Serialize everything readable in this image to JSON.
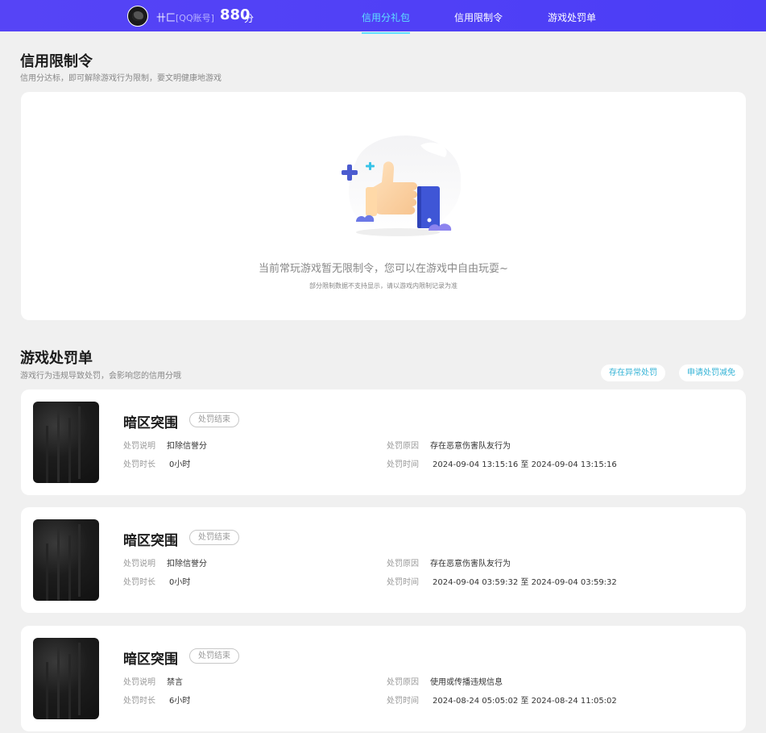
{
  "topbar": {
    "username": "卄匚",
    "account_type": "[QQ账号]",
    "score": "880",
    "score_unit": "分",
    "tabs": [
      {
        "label": "信用分礼包",
        "active": true
      },
      {
        "label": "信用限制令",
        "active": false
      },
      {
        "label": "游戏处罚单",
        "active": false
      }
    ]
  },
  "restriction": {
    "title": "信用限制令",
    "subtitle": "信用分达标，即可解除游戏行为限制，要文明健康地游戏",
    "empty_text": "当前常玩游戏暂无限制令，您可以在游戏中自由玩耍~",
    "empty_note": "部分限制数据不支持显示，请以游戏内限制记录为准"
  },
  "penalty": {
    "title": "游戏处罚单",
    "subtitle": "游戏行为违规导致处罚，会影响您的信用分哦",
    "actions": [
      "存在异常处罚",
      "申请处罚减免"
    ],
    "labels": {
      "desc": "处罚说明",
      "duration": "处罚时长",
      "reason": "处罚原因",
      "time": "处罚时间"
    },
    "items": [
      {
        "game": "暗区突围",
        "status": "处罚结束",
        "desc": "扣除信誉分",
        "duration": "0小时",
        "reason": "存在恶意伤害队友行为",
        "time": "2024-09-04 13:15:16 至 2024-09-04 13:15:16"
      },
      {
        "game": "暗区突围",
        "status": "处罚结束",
        "desc": "扣除信誉分",
        "duration": "0小时",
        "reason": "存在恶意伤害队友行为",
        "time": "2024-09-04 03:59:32 至 2024-09-04 03:59:32"
      },
      {
        "game": "暗区突围",
        "status": "处罚结束",
        "desc": "禁言",
        "duration": "6小时",
        "reason": "使用或传播违规信息",
        "time": "2024-08-24 05:05:02 至 2024-08-24 11:05:02"
      }
    ]
  },
  "colors": {
    "topbar": "#4b3df6",
    "active_tab": "#5ee0ff",
    "action_pill_text": "#34b3d6",
    "page_bg": "#f0f0f0"
  }
}
